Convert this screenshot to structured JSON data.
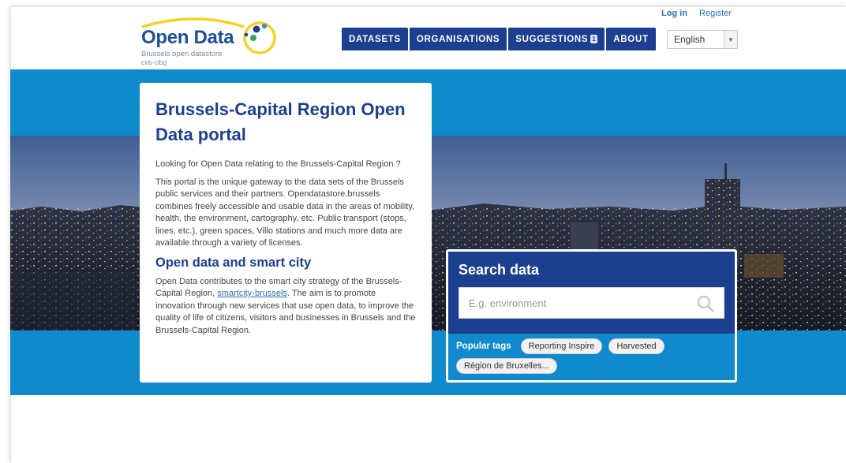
{
  "header": {
    "logo_title": "Open Data",
    "logo_subtitle": "Brussels open datastore",
    "logo_org": "cirb-cibg",
    "login_label": "Log in",
    "register_label": "Register"
  },
  "nav": {
    "datasets": "DATASETS",
    "organisations": "ORGANISATIONS",
    "suggestions": "SUGGESTIONS",
    "suggestions_badge": "1",
    "about": "ABOUT"
  },
  "language": {
    "selected": "English"
  },
  "intro": {
    "title": "Brussels-Capital Region Open Data portal",
    "question": "Looking for Open Data relating to the Brussels-Capital Region ?",
    "paragraph": "This portal is the unique gateway to the data sets of the Brussels public services and their partners. Opendatastore.brussels combines freely accessible and usable data in the areas of mobility, health, the environment, cartography, etc. Public transport (stops, lines, etc.), green spaces, Villo stations and much more data are available through a variety of licenses.",
    "subheading": "Open data and smart city",
    "smartcity_before": "Open Data contributes to the smart city strategy of the Brussels-Capital Region, ",
    "smartcity_link": "smartcity-brussels",
    "smartcity_after": ". The aim is to promote innovation through new services that use open data, to improve the quality of life of citizens, visitors and businesses in Brussels and the Brussels-Capital Region."
  },
  "search": {
    "title": "Search data",
    "placeholder": "E.g. environment",
    "popular_tags_label": "Popular tags",
    "tags": [
      "Reporting Inspire",
      "Harvested",
      "Région de Bruxelles..."
    ]
  },
  "colors": {
    "brand_dark_blue": "#1d3f8f",
    "hero_blue": "#0f8acd",
    "link_blue": "#2d6fb7",
    "logo_yellow": "#f4d21f"
  }
}
